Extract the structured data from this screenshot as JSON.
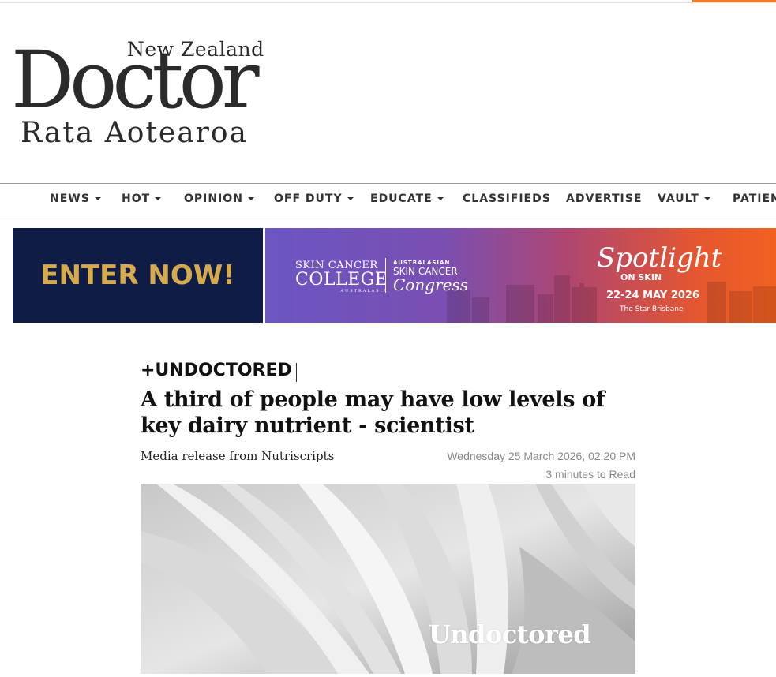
{
  "logo": {
    "top_text": "New Zealand",
    "main_text": "Doctor",
    "sub_text": "Rata Aotearoa"
  },
  "nav": {
    "items": [
      {
        "label": "NEWS",
        "dropdown": true
      },
      {
        "label": "HOT",
        "dropdown": true
      },
      {
        "label": "OPINION",
        "dropdown": true
      },
      {
        "label": "OFF DUTY",
        "dropdown": true
      },
      {
        "label": "EDUCATE",
        "dropdown": true
      },
      {
        "label": "CLASSIFIEDS",
        "dropdown": false
      },
      {
        "label": "ADVERTISE",
        "dropdown": false
      },
      {
        "label": "VAULT",
        "dropdown": true
      },
      {
        "label": "PATIEN",
        "dropdown": false
      }
    ]
  },
  "banner": {
    "cta": "ENTER NOW!",
    "college_line1": "SKIN CANCER",
    "college_line2": "COLLEGE",
    "college_line3": "AUSTRALASIA",
    "congress_line1": "AUSTRALASIAN",
    "congress_line2": "SKIN CANCER",
    "congress_line3": "Congress",
    "spotlight": "Spotlight",
    "on_skin": "ON SKIN",
    "dates": "22-24 MAY 2026",
    "venue": "The Star Brisbane"
  },
  "article": {
    "category": "+UNDOCTORED",
    "headline": "A third of people may have low levels of key dairy nutrient - scientist",
    "byline": "Media release from Nutriscripts",
    "date": "Wednesday 25 March 2026, 02:20 PM",
    "read_time": "3 minutes to Read",
    "image_watermark": "Undoctored"
  },
  "colors": {
    "accent_orange": "#f07f2a",
    "banner_navy": "#0f1d46",
    "banner_gold": "#d6aa4d"
  }
}
